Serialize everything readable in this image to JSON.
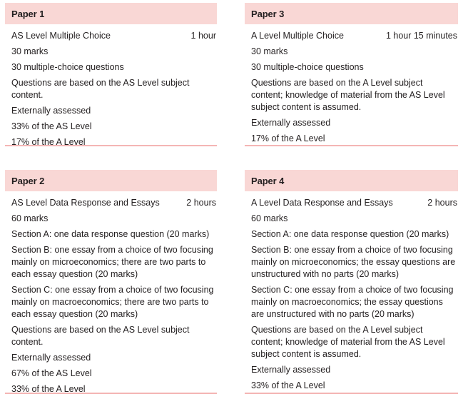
{
  "document": {
    "title": "Assessment overview",
    "accent_color": "#f9d7d5",
    "rule_color": "#f4b5b4",
    "text_color": "#231f20"
  },
  "papers": [
    {
      "header": "Paper 1",
      "name": "AS Level Multiple Choice",
      "duration": "1 hour",
      "details": [
        "30 marks",
        "30 multiple-choice questions",
        "Questions are based on the AS Level subject content.",
        "Externally assessed",
        "33% of the AS Level",
        "17% of the A Level"
      ]
    },
    {
      "header": "Paper 2",
      "name": "AS Level Data Response and Essays",
      "duration": "2 hours",
      "details": [
        "60 marks",
        "Section A: one data response question (20 marks)",
        "Section B: one essay from a choice of two focusing mainly on microeconomics; there are two parts to each essay question (20 marks)",
        "Section C: one essay from a choice of two focusing mainly on macroeconomics; there are two parts to each essay question (20 marks)",
        "Questions are based on the AS Level subject content.",
        "Externally assessed",
        "67% of the AS Level",
        "33% of the A Level"
      ]
    },
    {
      "header": "Paper 3",
      "name": "A Level Multiple Choice",
      "duration": "1 hour 15 minutes",
      "details": [
        "30 marks",
        "30 multiple-choice questions",
        "Questions are based on the A Level subject content; knowledge of material from the AS Level subject content is assumed.",
        "Externally assessed",
        "17% of the A Level"
      ]
    },
    {
      "header": "Paper 4",
      "name": "A Level Data Response and Essays",
      "duration": "2 hours",
      "details": [
        "60 marks",
        "Section A: one data response question (20 marks)",
        "Section B: one essay from a choice of two focusing mainly on microeconomics; the essay questions are unstructured with no parts (20 marks)",
        "Section C: one essay from a choice of two focusing mainly on macroeconomics; the essay questions are unstructured with no parts (20 marks)",
        "Questions are based on the A Level subject content; knowledge of material from the AS Level subject content is assumed.",
        "Externally assessed",
        "33% of the A Level"
      ]
    }
  ]
}
